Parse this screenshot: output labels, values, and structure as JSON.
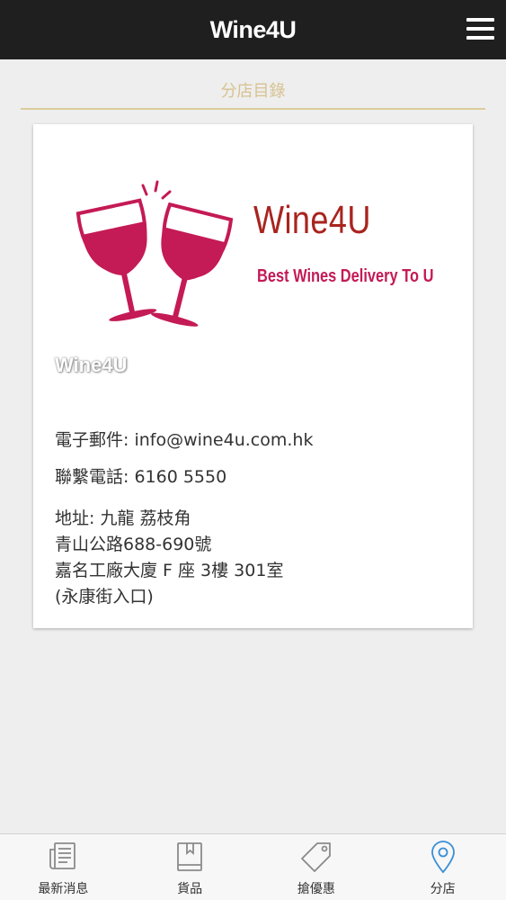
{
  "header": {
    "title": "Wine4U",
    "menu_icon": "hamburger-menu-icon"
  },
  "page": {
    "section_title": "分店目錄"
  },
  "store": {
    "logo": {
      "brand_name": "Wine4U",
      "tagline": "Best Wines Delivery To U",
      "watermark": "Wine4U",
      "icon": "wine-glasses-cheers-icon"
    },
    "email": "電子郵件: info@wine4u.com.hk",
    "phone": "聯繫電話: 6160 5550",
    "address": {
      "line1": "地址: 九龍 荔枝角",
      "line2": "青山公路688-690號",
      "line3": "嘉名工廠大廈 F 座 3樓 301室",
      "line4": "(永康街入口)"
    }
  },
  "bottom_nav": {
    "items": [
      {
        "label": "最新消息",
        "icon": "newspaper-icon",
        "active": false
      },
      {
        "label": "貨品",
        "icon": "book-icon",
        "active": false
      },
      {
        "label": "搶優惠",
        "icon": "tag-icon",
        "active": false
      },
      {
        "label": "分店",
        "icon": "location-pin-icon",
        "active": true
      }
    ]
  },
  "colors": {
    "header_bg": "#1f1f1f",
    "section_title": "#d8c290",
    "brand_red": "#a9241f",
    "wine_magenta": "#c41a55",
    "active_tab": "#3a8fd6",
    "inactive_icon": "#8a8a8a"
  }
}
